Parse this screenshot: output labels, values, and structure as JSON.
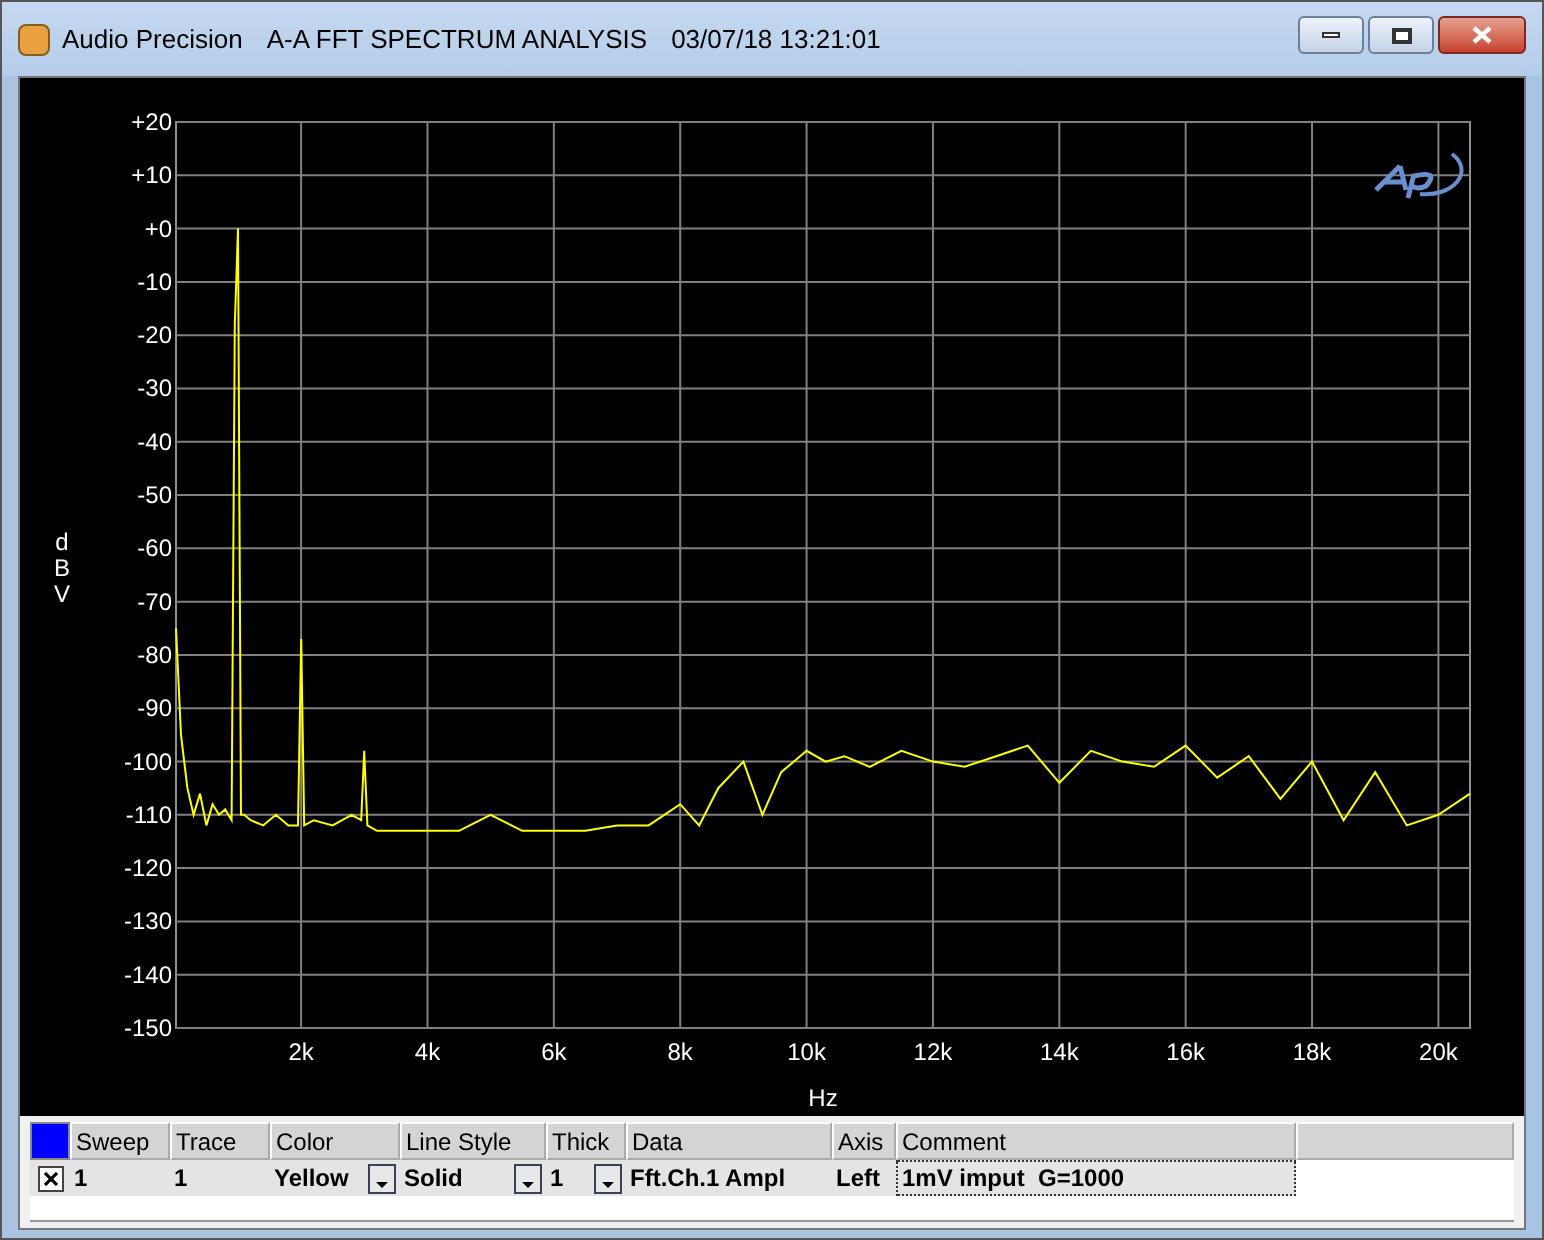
{
  "window": {
    "app": "Audio Precision",
    "title": "A-A FFT SPECTRUM ANALYSIS",
    "timestamp": "03/07/18 13:21:01"
  },
  "graph": {
    "chart_data": {
      "type": "line",
      "grid": true,
      "xlabel": "Hz",
      "ylabel": "dBV",
      "xlim": [
        20,
        20500
      ],
      "ylim": [
        -150,
        20
      ],
      "xticks": [
        {
          "value": 2000,
          "label": "2k"
        },
        {
          "value": 4000,
          "label": "4k"
        },
        {
          "value": 6000,
          "label": "6k"
        },
        {
          "value": 8000,
          "label": "8k"
        },
        {
          "value": 10000,
          "label": "10k"
        },
        {
          "value": 12000,
          "label": "12k"
        },
        {
          "value": 14000,
          "label": "14k"
        },
        {
          "value": 16000,
          "label": "16k"
        },
        {
          "value": 18000,
          "label": "18k"
        },
        {
          "value": 20000,
          "label": "20k"
        }
      ],
      "yticks": [
        {
          "value": 20,
          "label": "+20"
        },
        {
          "value": 10,
          "label": "+10"
        },
        {
          "value": 0,
          "label": "+0"
        },
        {
          "value": -10,
          "label": "-10"
        },
        {
          "value": -20,
          "label": "-20"
        },
        {
          "value": -30,
          "label": "-30"
        },
        {
          "value": -40,
          "label": "-40"
        },
        {
          "value": -50,
          "label": "-50"
        },
        {
          "value": -60,
          "label": "-60"
        },
        {
          "value": -70,
          "label": "-70"
        },
        {
          "value": -80,
          "label": "-80"
        },
        {
          "value": -90,
          "label": "-90"
        },
        {
          "value": -100,
          "label": "-100"
        },
        {
          "value": -110,
          "label": "-110"
        },
        {
          "value": -120,
          "label": "-120"
        },
        {
          "value": -130,
          "label": "-130"
        },
        {
          "value": -140,
          "label": "-140"
        },
        {
          "value": -150,
          "label": "-150"
        }
      ],
      "x": [
        20,
        100,
        200,
        300,
        400,
        500,
        600,
        700,
        800,
        900,
        950,
        1000,
        1050,
        1100,
        1200,
        1400,
        1600,
        1800,
        1950,
        2000,
        2050,
        2200,
        2500,
        2800,
        2950,
        3000,
        3050,
        3200,
        3500,
        4000,
        4500,
        5000,
        5500,
        6000,
        6500,
        7000,
        7500,
        8000,
        8300,
        8600,
        9000,
        9300,
        9600,
        10000,
        10300,
        10600,
        11000,
        11500,
        12000,
        12500,
        13000,
        13500,
        14000,
        14500,
        15000,
        15500,
        16000,
        16500,
        17000,
        17500,
        18000,
        18500,
        19000,
        19500,
        20000,
        20500
      ],
      "series": [
        {
          "color": "#ffff00",
          "values": [
            -75,
            -95,
            -105,
            -110,
            -106,
            -112,
            -108,
            -110,
            -109,
            -111,
            -18,
            0,
            -110,
            -110,
            -111,
            -112,
            -110,
            -112,
            -112,
            -77,
            -112,
            -111,
            -112,
            -110,
            -111,
            -98,
            -112,
            -113,
            -113,
            -113,
            -113,
            -110,
            -113,
            -113,
            -113,
            -112,
            -112,
            -108,
            -112,
            -105,
            -100,
            -110,
            -102,
            -98,
            -100,
            -99,
            -101,
            -98,
            -100,
            -101,
            -99,
            -97,
            -104,
            -98,
            -100,
            -101,
            -97,
            -103,
            -99,
            -107,
            -100,
            -111,
            -102,
            -112,
            -110,
            -106
          ]
        }
      ]
    }
  },
  "trace_table": {
    "columns": [
      "Sweep",
      "Trace",
      "Color",
      "Line Style",
      "Thick",
      "Data",
      "Axis",
      "Comment"
    ],
    "rows": [
      {
        "checked": true,
        "sweep": "1",
        "trace": "1",
        "color_name": "Yellow",
        "line_style": "Solid",
        "thick": "1",
        "data": "Fft.Ch.1 Ampl",
        "axis": "Left",
        "comment": "1mV imput  G=1000"
      }
    ]
  }
}
